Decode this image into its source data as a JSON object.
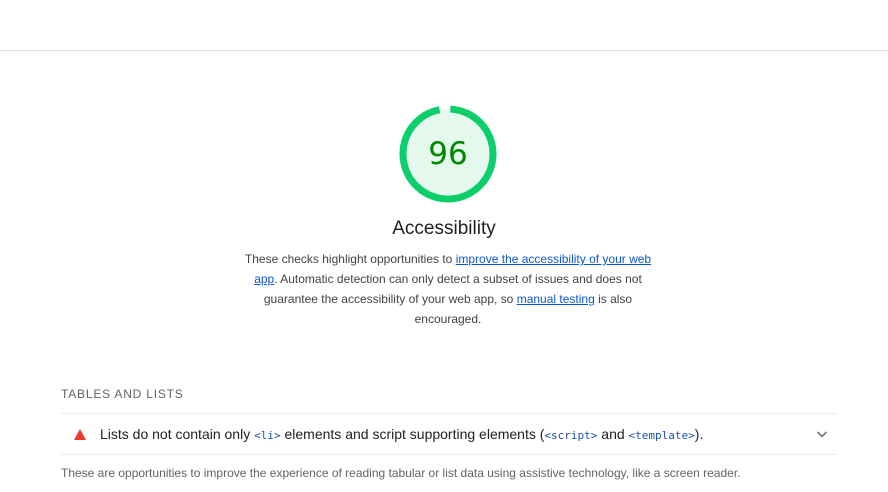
{
  "colors": {
    "gauge_pass": "#0cce6b",
    "gauge_fill": "#e5f8ed",
    "score_text": "#008800",
    "link": "#0b57d0",
    "fail": "#eb3b2e"
  },
  "category": {
    "score": "96",
    "score_fraction": 0.96,
    "title": "Accessibility",
    "description": {
      "part1": "These checks highlight opportunities to ",
      "link1": "improve the accessibility of your web app",
      "part2": ". Automatic detection can only detect a subset of issues and does not guarantee the accessibility of your web app, so ",
      "link2": "manual testing",
      "part3": " is also encouraged."
    }
  },
  "group": {
    "title": "TABLES AND LISTS",
    "description": "These are opportunities to improve the experience of reading tabular or list data using assistive technology, like a screen reader."
  },
  "audit": {
    "status_icon": "fail-triangle-icon",
    "text1": "Lists do not contain only ",
    "code1": "<li>",
    "text2": " elements and script supporting elements (",
    "code2": "<script>",
    "text3": " and ",
    "code3": "<template>",
    "text4": ").",
    "expand_icon": "chevron-down-icon"
  }
}
